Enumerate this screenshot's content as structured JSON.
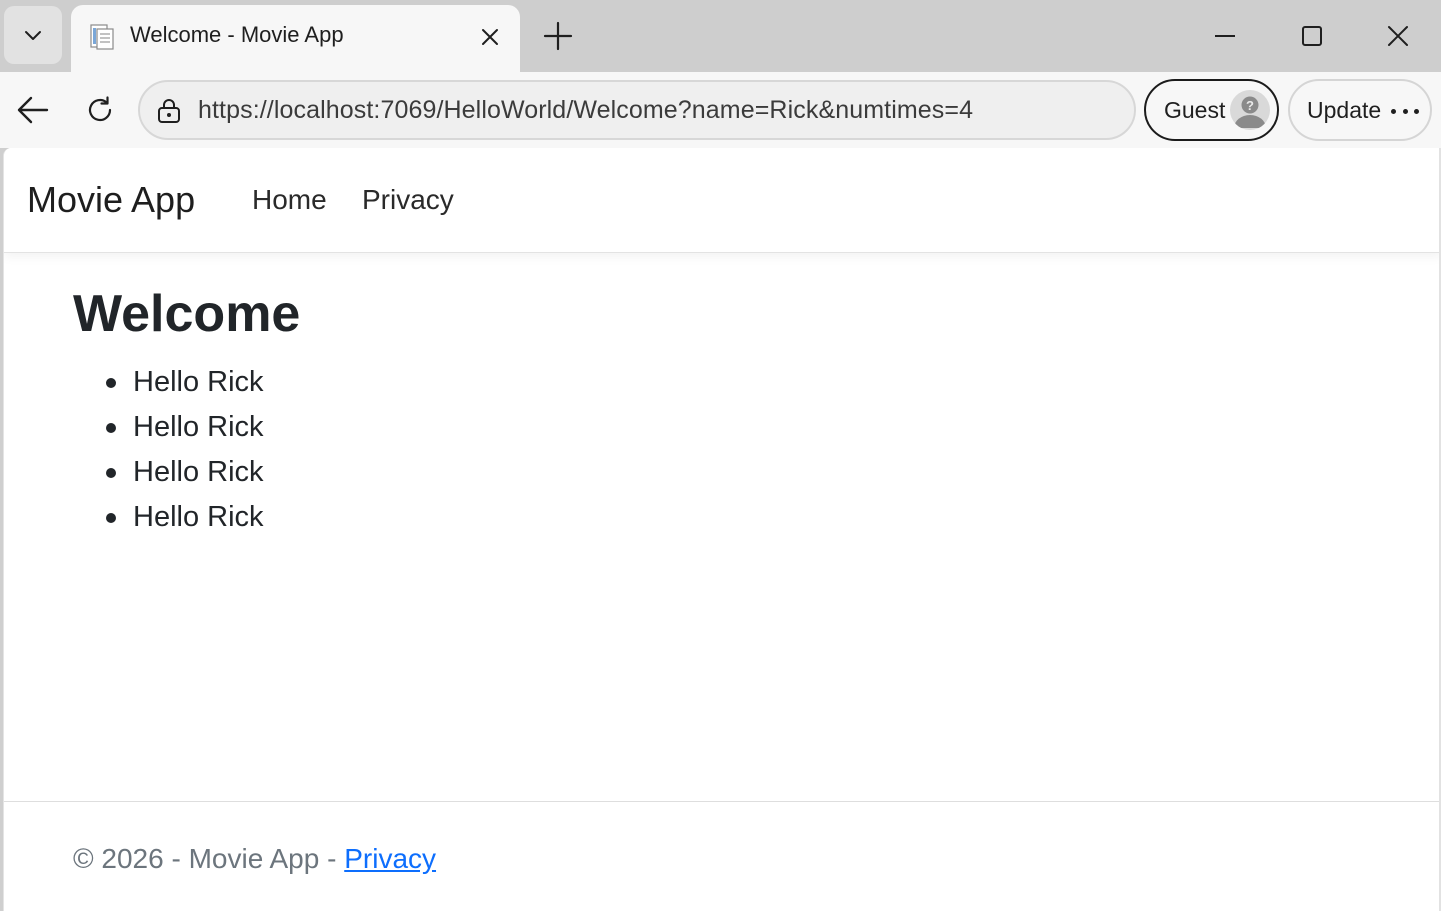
{
  "browser": {
    "tab": {
      "title": "Welcome - Movie App"
    },
    "address_bar": {
      "url": "https://localhost:7069/HelloWorld/Welcome?name=Rick&numtimes=4"
    },
    "profile_button": {
      "label": "Guest"
    },
    "update_button": {
      "label": "Update"
    }
  },
  "site": {
    "brand": "Movie App",
    "nav": [
      {
        "label": "Home"
      },
      {
        "label": "Privacy"
      }
    ]
  },
  "main": {
    "title": "Welcome",
    "greetings": [
      "Hello Rick",
      "Hello Rick",
      "Hello Rick",
      "Hello Rick"
    ]
  },
  "footer": {
    "text": "© 2026 - Movie App - ",
    "link_label": "Privacy"
  },
  "colors": {
    "link": "#0d6efd",
    "text": "#212529",
    "muted": "#6c757d"
  }
}
